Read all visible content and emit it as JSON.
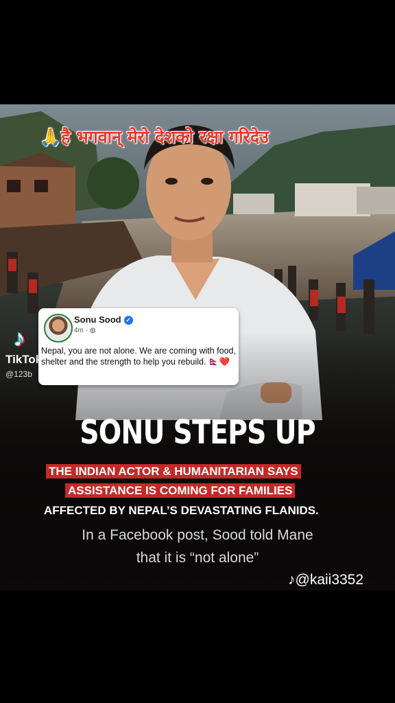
{
  "poster": {
    "hindi_banner": "🙏है भगवान् मेरो देशको रक्षा गरिदेउ",
    "headline": "SONU STEPS UP",
    "subline_1": "THE INDIAN ACTOR & HUMANITARIAN SAYS",
    "subline_2": "ASSISTANCE IS COMING FOR FAMILIES",
    "subline_3": "AFFECTED BY NEPAL’S DEVASTATING FLANIDS.",
    "caption_1": "In a Facebook post, Sood told Mane",
    "caption_2": "that it is “not alone”"
  },
  "facebook_post": {
    "author": "Sonu Sood",
    "meta": "4m · ",
    "text": "Nepal, you are not alone. We are coming with food, shelter and the strength to help you rebuild. 🇳🇵❤️"
  },
  "tiktok": {
    "brand": "TikTok",
    "username": "@123b",
    "watermark_handle": "@kaii3352"
  },
  "colors": {
    "accent_red": "#c62828",
    "hindi_red": "#e53a2a",
    "verified_blue": "#1877f2"
  }
}
